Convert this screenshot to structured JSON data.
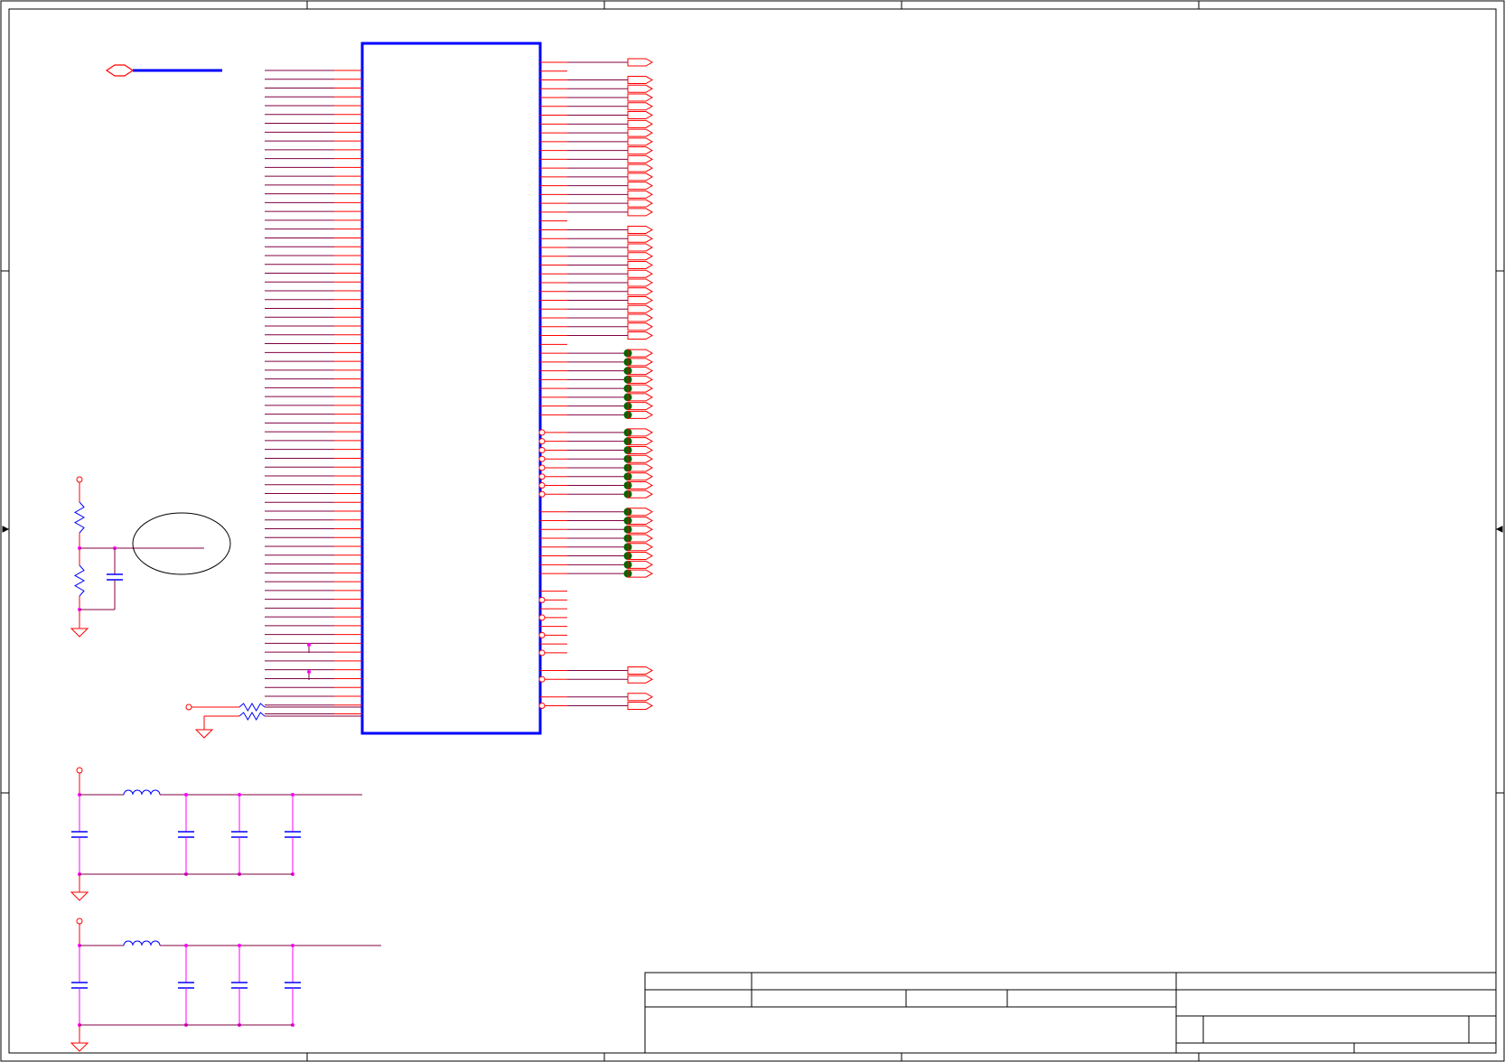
{
  "colors": {
    "frame": "#000000",
    "component": "#0000ff",
    "pin": "#ff0000",
    "net": "#800040",
    "junction": "#ff00ff",
    "testpoint": "#006400",
    "ellipse": "#000000"
  },
  "chip": {
    "left_pin_count": 74,
    "right_pin_count": 74
  },
  "right_pins": {
    "port_group_1_count": 16,
    "port_group_2_count": 13,
    "testpoint_group_1_count": 8,
    "testpoint_group_2_count": 8,
    "testpoint_group_3_count": 8,
    "no_connect_count": 8,
    "bottom_port_count": 4
  },
  "filters": {
    "count": 2,
    "capacitors_per_filter": 4
  }
}
